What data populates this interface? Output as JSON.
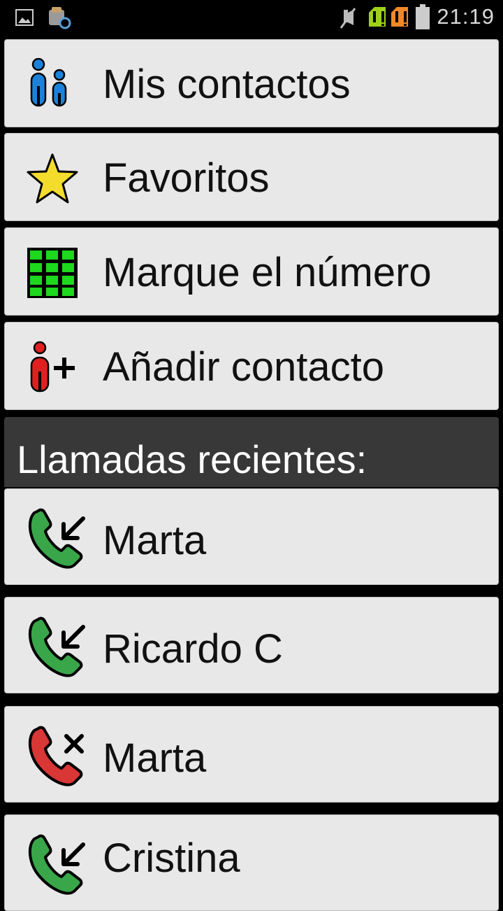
{
  "status_bar": {
    "time": "21:19",
    "left_icons": [
      "image-icon",
      "app-update-icon"
    ],
    "right_icons": [
      "mute-icon",
      "sim1-signal-icon",
      "sim2-signal-icon",
      "battery-icon"
    ]
  },
  "menu": {
    "items": [
      {
        "label": "Mis contactos",
        "icon": "contacts-icon"
      },
      {
        "label": "Favoritos",
        "icon": "star-icon"
      },
      {
        "label": "Marque el número",
        "icon": "dialpad-icon"
      },
      {
        "label": "Añadir contacto",
        "icon": "add-contact-icon"
      }
    ]
  },
  "recent_calls": {
    "title": "Llamadas recientes:",
    "items": [
      {
        "name": "Marta",
        "type": "incoming",
        "icon": "incoming-call-icon",
        "color": "#3aa64a"
      },
      {
        "name": "Ricardo C",
        "type": "incoming",
        "icon": "incoming-call-icon",
        "color": "#3aa64a"
      },
      {
        "name": "Marta",
        "type": "missed",
        "icon": "missed-call-icon",
        "color": "#d93636"
      },
      {
        "name": "Cristina",
        "type": "incoming",
        "icon": "incoming-call-icon",
        "color": "#3aa64a"
      }
    ]
  }
}
